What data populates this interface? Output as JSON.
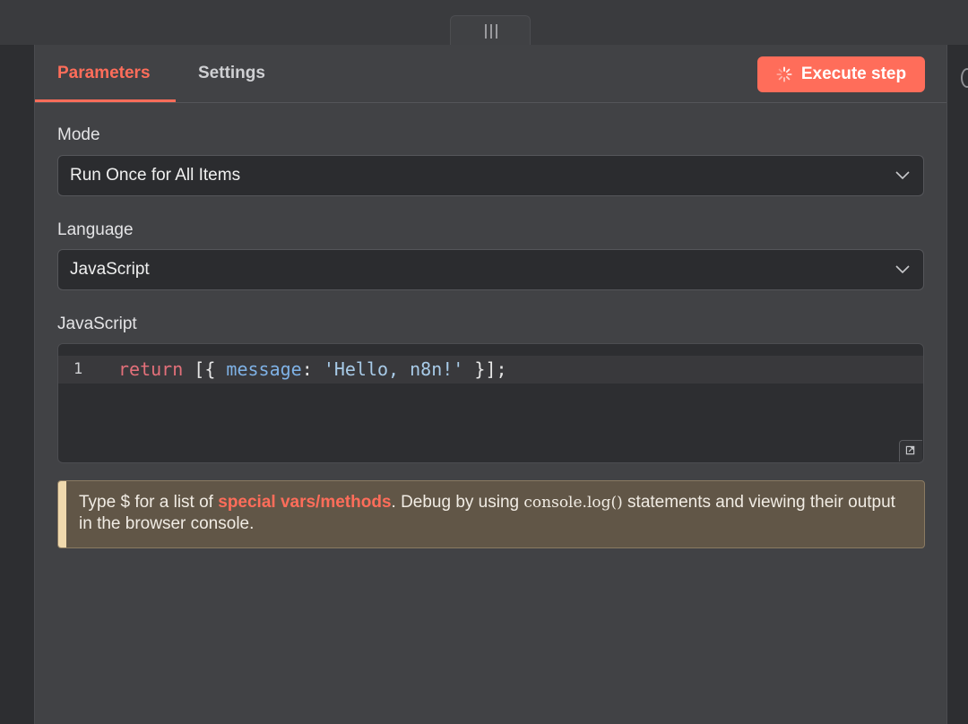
{
  "tabs": [
    {
      "label": "Parameters",
      "active": true
    },
    {
      "label": "Settings",
      "active": false
    }
  ],
  "execute_button": {
    "label": "Execute step",
    "icon": "spinner-icon"
  },
  "fields": {
    "mode": {
      "label": "Mode",
      "value": "Run Once for All Items"
    },
    "language": {
      "label": "Language",
      "value": "JavaScript"
    },
    "code": {
      "label": "JavaScript",
      "line_number": "1",
      "tokens": {
        "kw": "return",
        "open": " [{ ",
        "prop": "message",
        "colon": ": ",
        "str": "'Hello, n8n!'",
        "close": " }];"
      }
    }
  },
  "notice": {
    "text_before": "Type $ for a list of ",
    "link": "special vars/methods",
    "text_mid": ". Debug by using ",
    "code": "console.log()",
    "text_after": " statements and viewing their output in the browser console."
  },
  "colors": {
    "accent": "#ff6d5a",
    "panel_bg": "#414245",
    "input_bg": "#2b2c2f",
    "notice_bg": "#615647",
    "notice_stripe": "#f0d9ad"
  }
}
